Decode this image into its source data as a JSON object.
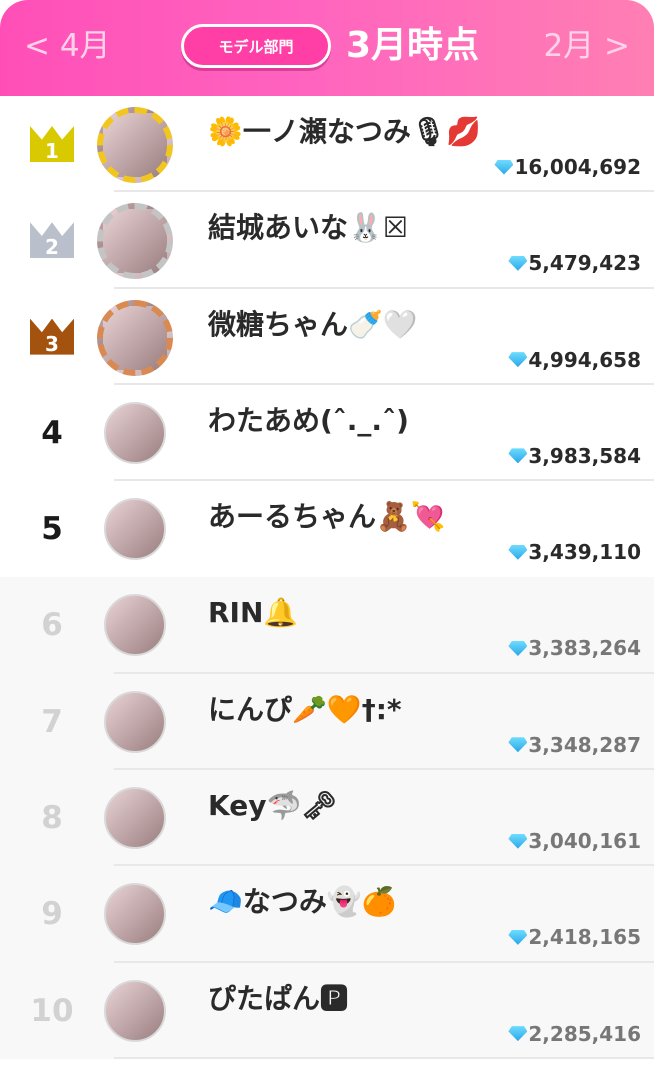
{
  "header": {
    "prev_label": "< 4月",
    "next_label": "2月 >",
    "department": "モデル部門",
    "period": "3月時点"
  },
  "colors": {
    "header_gradient": [
      "#ff4fb7",
      "#ff7fb3"
    ],
    "gold": "#d9c900",
    "silver": "#b9bfcb",
    "bronze": "#a3530d",
    "gem": "#3db8f0"
  },
  "ranking": [
    {
      "rank": "1",
      "name": "🌼一ノ瀬なつみ🎙💋",
      "score": "16,004,692",
      "badge": "gold-crown-icon"
    },
    {
      "rank": "2",
      "name": "結城あいな🐰☒",
      "score": "5,479,423",
      "badge": "silver-crown-icon"
    },
    {
      "rank": "3",
      "name": "微糖ちゃん🍼🤍",
      "score": "4,994,658",
      "badge": "bronze-crown-icon"
    },
    {
      "rank": "4",
      "name": "わたあめ(ˆ._.ˆ)",
      "score": "3,983,584"
    },
    {
      "rank": "5",
      "name": "あーるちゃん🧸💘",
      "score": "3,439,110"
    },
    {
      "rank": "6",
      "name": "RIN🔔",
      "score": "3,383,264"
    },
    {
      "rank": "7",
      "name": "にんぴ🥕🧡†:*",
      "score": "3,348,287"
    },
    {
      "rank": "8",
      "name": "Key🦈🗝",
      "score": "3,040,161"
    },
    {
      "rank": "9",
      "name": "🧢なつみ👻🍊",
      "score": "2,418,165"
    },
    {
      "rank": "10",
      "name": "ぴたぱん🅿",
      "score": "2,285,416"
    }
  ]
}
